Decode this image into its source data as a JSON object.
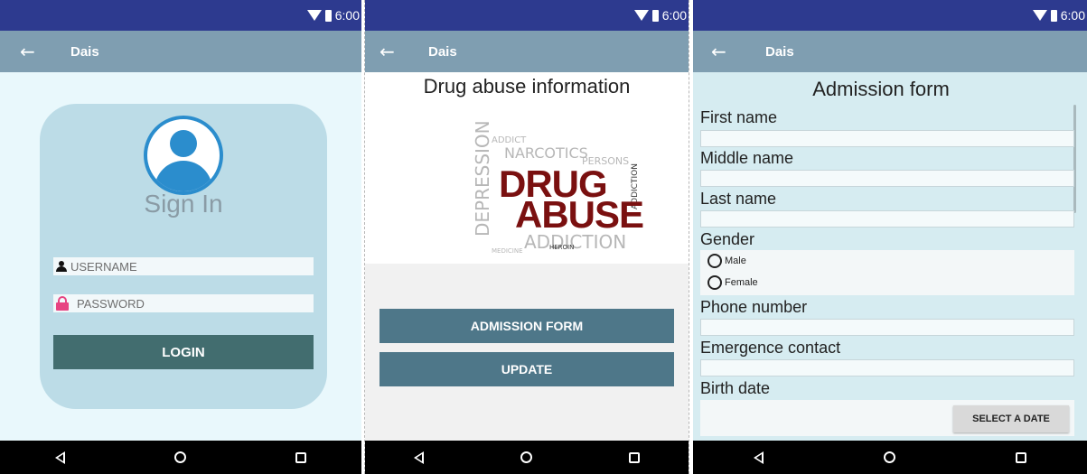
{
  "status": {
    "time": "6:00"
  },
  "app": {
    "title": "Dais"
  },
  "signin": {
    "heading": "Sign In",
    "username_placeholder": "USERNAME",
    "password_placeholder": "PASSWORD",
    "login_label": "LOGIN"
  },
  "drug_info": {
    "heading": "Drug abuse information",
    "banner_main": [
      "DRUG",
      "ABUSE"
    ],
    "banner_words": [
      "ADDICTION",
      "NARCOTICS",
      "DEPRESSION",
      "ADDICT",
      "HEROIN",
      "MEDICINE",
      "PERSONS",
      "ADDICTION"
    ],
    "buttons": [
      "ADMISSION FORM",
      "UPDATE"
    ]
  },
  "admission": {
    "heading": "Admission form",
    "labels": {
      "first_name": "First name",
      "middle_name": "Middle name",
      "last_name": "Last name",
      "gender": "Gender",
      "phone": "Phone number",
      "emergency": "Emergence contact",
      "birth": "Birth date"
    },
    "gender_options": [
      "Male",
      "Female"
    ],
    "date_button": "SELECT A DATE"
  },
  "colors": {
    "status_bar": "#2d3a8f",
    "app_bar": "#7f9eb1",
    "login_button": "#426d6f",
    "menu_button": "#4e7789",
    "avatar": "#2b8dcd",
    "lock": "#e74482"
  },
  "icons": [
    "back-arrow-icon",
    "wifi-icon",
    "battery-icon",
    "user-avatar-icon",
    "user-icon",
    "lock-icon",
    "nav-back-icon",
    "nav-home-icon",
    "nav-recents-icon"
  ]
}
